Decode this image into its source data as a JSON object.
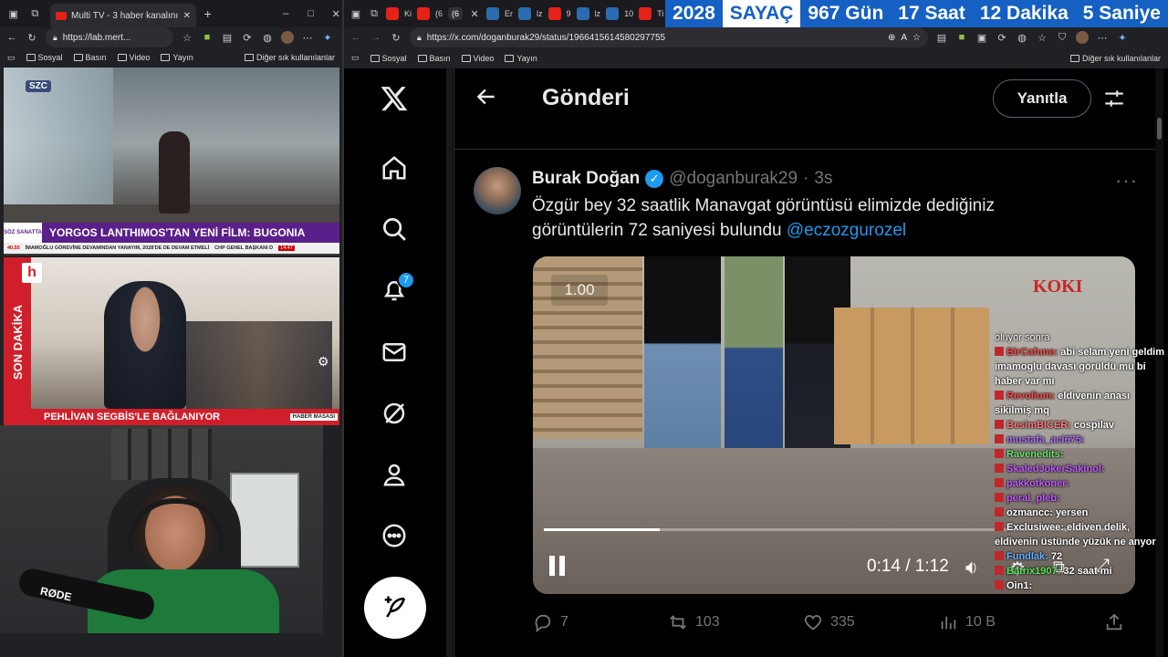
{
  "left_browser": {
    "tab_title": "Multi TV - 3 haber kanalını aynı a",
    "url": "https://lab.mert...",
    "bookmarks": [
      "Sosyal",
      "Basın",
      "Video",
      "Yayın"
    ],
    "other_bookmarks": "Diğer sık kullanılanlar"
  },
  "panel1": {
    "logo": "SZC",
    "ticker_tag": "SÖZ SANATTA",
    "headline": "YORGOS LANTHIMOS'TAN YENİ FİLM: BUGONIA",
    "subticker": "İMAMOĞLU GÖREVİNE DEVAMINDAN YANAYIM, 2028'DE DE DEVAM ETMELİ",
    "subticker2": "CHP GENEL BAŞKANI D",
    "price": "40,55",
    "time": "14:47"
  },
  "panel2": {
    "logo": "h",
    "side_label": "SON DAKİKA",
    "headline": "PEHLİVAN SEGBİS'LE BAĞLANIYOR",
    "tag": "HABER MASASI"
  },
  "panel3": {
    "mic_brand": "RØDE"
  },
  "right_browser": {
    "url": "https://x.com/doganburak29/status/1966415614580297755",
    "bookmarks": [
      "Sosyal",
      "Basın",
      "Video",
      "Yayın"
    ],
    "other_bookmarks": "Diğer sık kullanılanlar",
    "tabs_text": [
      "Ki",
      "(6",
      "(6",
      "Er",
      "lz",
      "9",
      "lz",
      "10",
      "Ti"
    ]
  },
  "counter": {
    "year": "2028",
    "label": "SAYAÇ",
    "days": "967 Gün",
    "hours": "17 Saat",
    "minutes": "12 Dakika",
    "seconds": "5 Saniye"
  },
  "x": {
    "notification_count": "7",
    "header_title": "Gönderi",
    "reply_button": "Yanıtla",
    "author_name": "Burak Doğan",
    "author_handle": "@doganburak29",
    "separator": "·",
    "time_ago": "3s",
    "tweet_line1": "Özgür bey 32 saatlik Manavgat görüntüsü elimizde dediğiniz",
    "tweet_line2": "görüntülerin 72 saniyesi bulundu",
    "mention": "@eczozgurozel",
    "video_speed": "1.00",
    "video_logo": "KOKI",
    "video_time": "0:14 / 1:12",
    "video_progress": 0.2,
    "replies": "7",
    "reposts": "103",
    "likes": "335",
    "views": "10 B"
  },
  "chat": [
    {
      "user": "",
      "text": "oluyor sonra",
      "color": "#ffffff"
    },
    {
      "user": "BirCafune:",
      "text": "abi selam yeni geldim imamoglu davası görüldü mü bi haber var mı",
      "color": "#ff4d4d"
    },
    {
      "user": "Revolium:",
      "text": "eldivenin anası sikilmiş mq",
      "color": "#ff4d4d"
    },
    {
      "user": "BesimBICER:",
      "text": "cospilav",
      "color": "#ff7b7b"
    },
    {
      "user": "mustafa_aci675:",
      "text": "",
      "color": "#b06cff"
    },
    {
      "user": "Ravenedits:",
      "text": "",
      "color": "#6fe36f"
    },
    {
      "user": "SkaledJokerSakinol:",
      "text": "",
      "color": "#c45cff"
    },
    {
      "user": "pakkotkoner:",
      "text": "",
      "color": "#c45cff"
    },
    {
      "user": "peral_pleb:",
      "text": "",
      "color": "#c45cff"
    },
    {
      "user": "ozmancc:",
      "text": "yersen",
      "color": "#ffffff"
    },
    {
      "user": "Exclusiwee:",
      "text": "eldiven delik, eldivenin üstünde yüzük ne anyor",
      "color": "#ffffff"
    },
    {
      "user": "Fundlak:",
      "text": "72",
      "color": "#66b3ff"
    },
    {
      "user": "Batrix1907:",
      "text": "32 saat mi",
      "color": "#5ce65c"
    },
    {
      "user": "Oin1:",
      "text": "",
      "color": "#ffffff"
    }
  ]
}
